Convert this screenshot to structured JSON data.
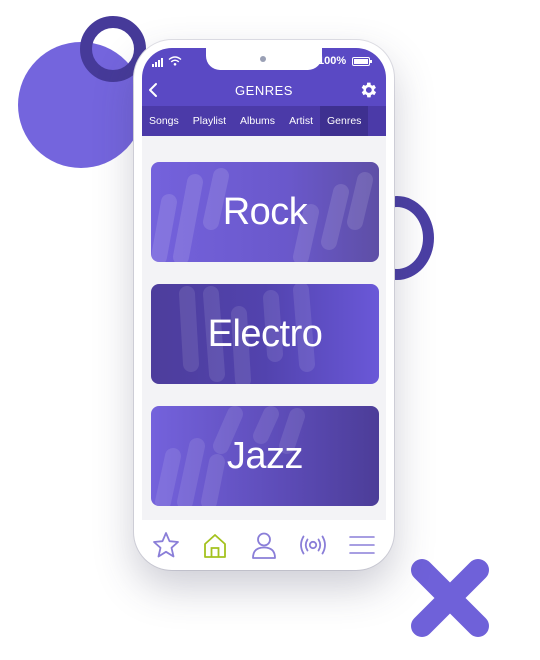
{
  "status_bar": {
    "battery_percent": "100%"
  },
  "header": {
    "title": "GENRES"
  },
  "tabs": [
    {
      "label": "Songs",
      "active": false
    },
    {
      "label": "Playlist",
      "active": false
    },
    {
      "label": "Albums",
      "active": false
    },
    {
      "label": "Artist",
      "active": false
    },
    {
      "label": "Genres",
      "active": true
    }
  ],
  "genres": [
    {
      "label": "Rock"
    },
    {
      "label": "Electro"
    },
    {
      "label": "Jazz"
    }
  ],
  "bottom_nav": [
    {
      "icon": "star-icon"
    },
    {
      "icon": "home-icon",
      "active": true
    },
    {
      "icon": "user-icon"
    },
    {
      "icon": "broadcast-icon"
    },
    {
      "icon": "menu-icon"
    }
  ],
  "colors": {
    "header_purple": "#5a49c4",
    "tab_bar": "#4b3aa8",
    "nav_icon": "#8a7ed8",
    "nav_active": "#a4c21e"
  }
}
